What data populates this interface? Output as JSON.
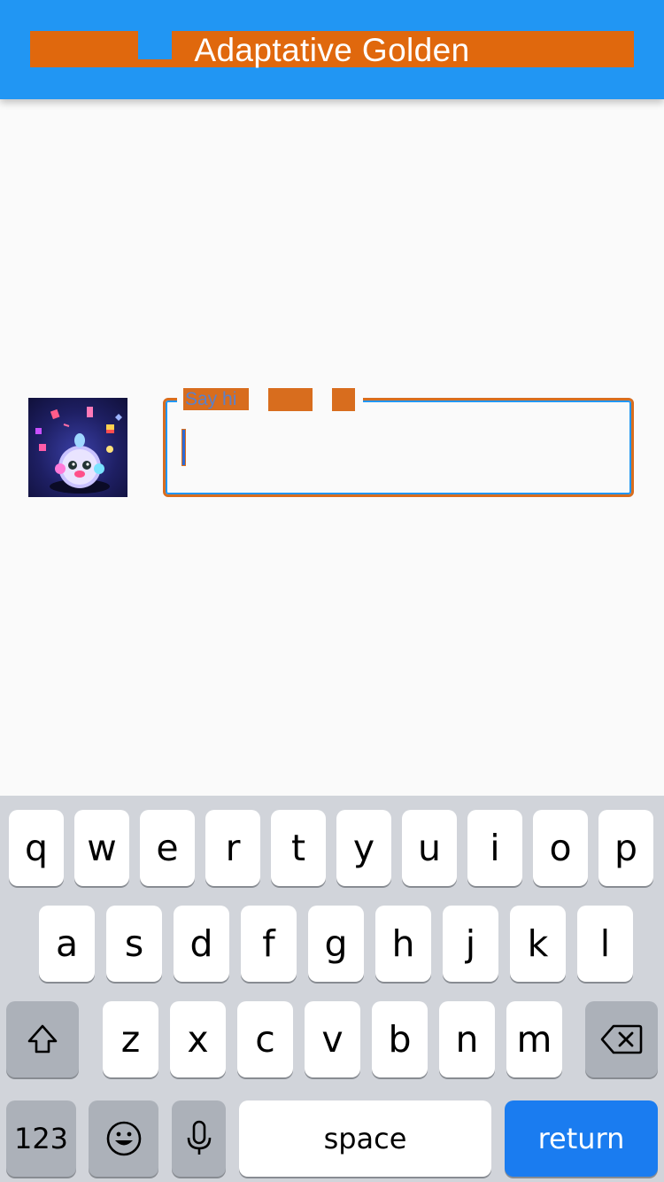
{
  "app_bar": {
    "title": "Adaptative Golden"
  },
  "text_field": {
    "label": "Say hi",
    "value": ""
  },
  "keyboard": {
    "row1": [
      "q",
      "w",
      "e",
      "r",
      "t",
      "y",
      "u",
      "i",
      "o",
      "p"
    ],
    "row2": [
      "a",
      "s",
      "d",
      "f",
      "g",
      "h",
      "j",
      "k",
      "l"
    ],
    "row3": [
      "z",
      "x",
      "c",
      "v",
      "b",
      "n",
      "m"
    ],
    "numbers_label": "123",
    "space_label": "space",
    "return_label": "return"
  },
  "colors": {
    "app_bar": "#2196f3",
    "overlay": "#e0680d",
    "return_key": "#1a7cf0",
    "keyboard_bg": "#d1d4da"
  },
  "icons": {
    "shift": "shift-icon",
    "backspace": "backspace-icon",
    "emoji": "emoji-icon",
    "mic": "microphone-icon"
  }
}
